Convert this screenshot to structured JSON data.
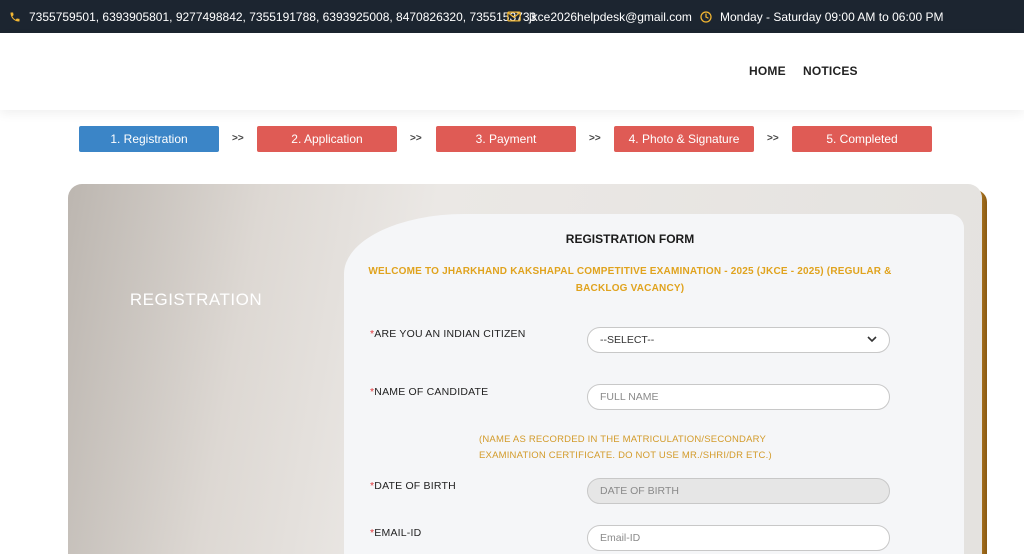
{
  "topbar": {
    "phones": "7355759501, 6393905801, 9277498842, 7355191788, 6393925008, 8470826320, 7355153733",
    "email": "jkce2026helpdesk@gmail.com",
    "hours": "Monday - Saturday 09:00 AM to 06:00 PM"
  },
  "nav": {
    "home": "HOME",
    "notices": "NOTICES"
  },
  "steps": [
    {
      "label": "1. Registration",
      "status": "active",
      "color": "#3b85c7"
    },
    {
      "label": "2. Application",
      "status": "pending",
      "color": "#df5b55"
    },
    {
      "label": "3. Payment",
      "status": "pending",
      "color": "#df5b55"
    },
    {
      "label": "4. Photo & Signature",
      "status": "pending",
      "color": "#df5b55"
    },
    {
      "label": "5. Completed",
      "status": "pending",
      "color": "#df5b55"
    }
  ],
  "step_separator": ">>",
  "left_panel": {
    "title": "REGISTRATION"
  },
  "form": {
    "title": "REGISTRATION FORM",
    "welcome": "WELCOME TO JHARKHAND KAKSHAPAL COMPETITIVE EXAMINATION - 2025 (JKCE - 2025) (REGULAR & BACKLOG VACANCY)",
    "required_mark": "*",
    "fields": {
      "citizen": {
        "label": "ARE YOU AN INDIAN CITIZEN",
        "selected": "--SELECT--"
      },
      "name": {
        "label": "NAME OF CANDIDATE",
        "placeholder": "FULL NAME",
        "note": "(NAME AS RECORDED IN THE MATRICULATION/SECONDARY EXAMINATION CERTIFICATE. DO NOT USE MR./SHRI/DR ETC.)"
      },
      "dob": {
        "label": "DATE OF BIRTH",
        "placeholder": "DATE OF BIRTH"
      },
      "email": {
        "label": "EMAIL-ID",
        "placeholder": "Email-ID"
      }
    }
  },
  "colors": {
    "topbar_bg": "#1c2530",
    "icon_accent": "#f2b632",
    "step_active": "#3b85c7",
    "step_pending": "#df5b55",
    "welcome_text": "#e0a31e",
    "required": "#e0373a"
  },
  "icons": {
    "phone": "phone-icon",
    "email": "envelope-icon",
    "hours": "clock-icon",
    "select": "chevron-down-icon"
  }
}
